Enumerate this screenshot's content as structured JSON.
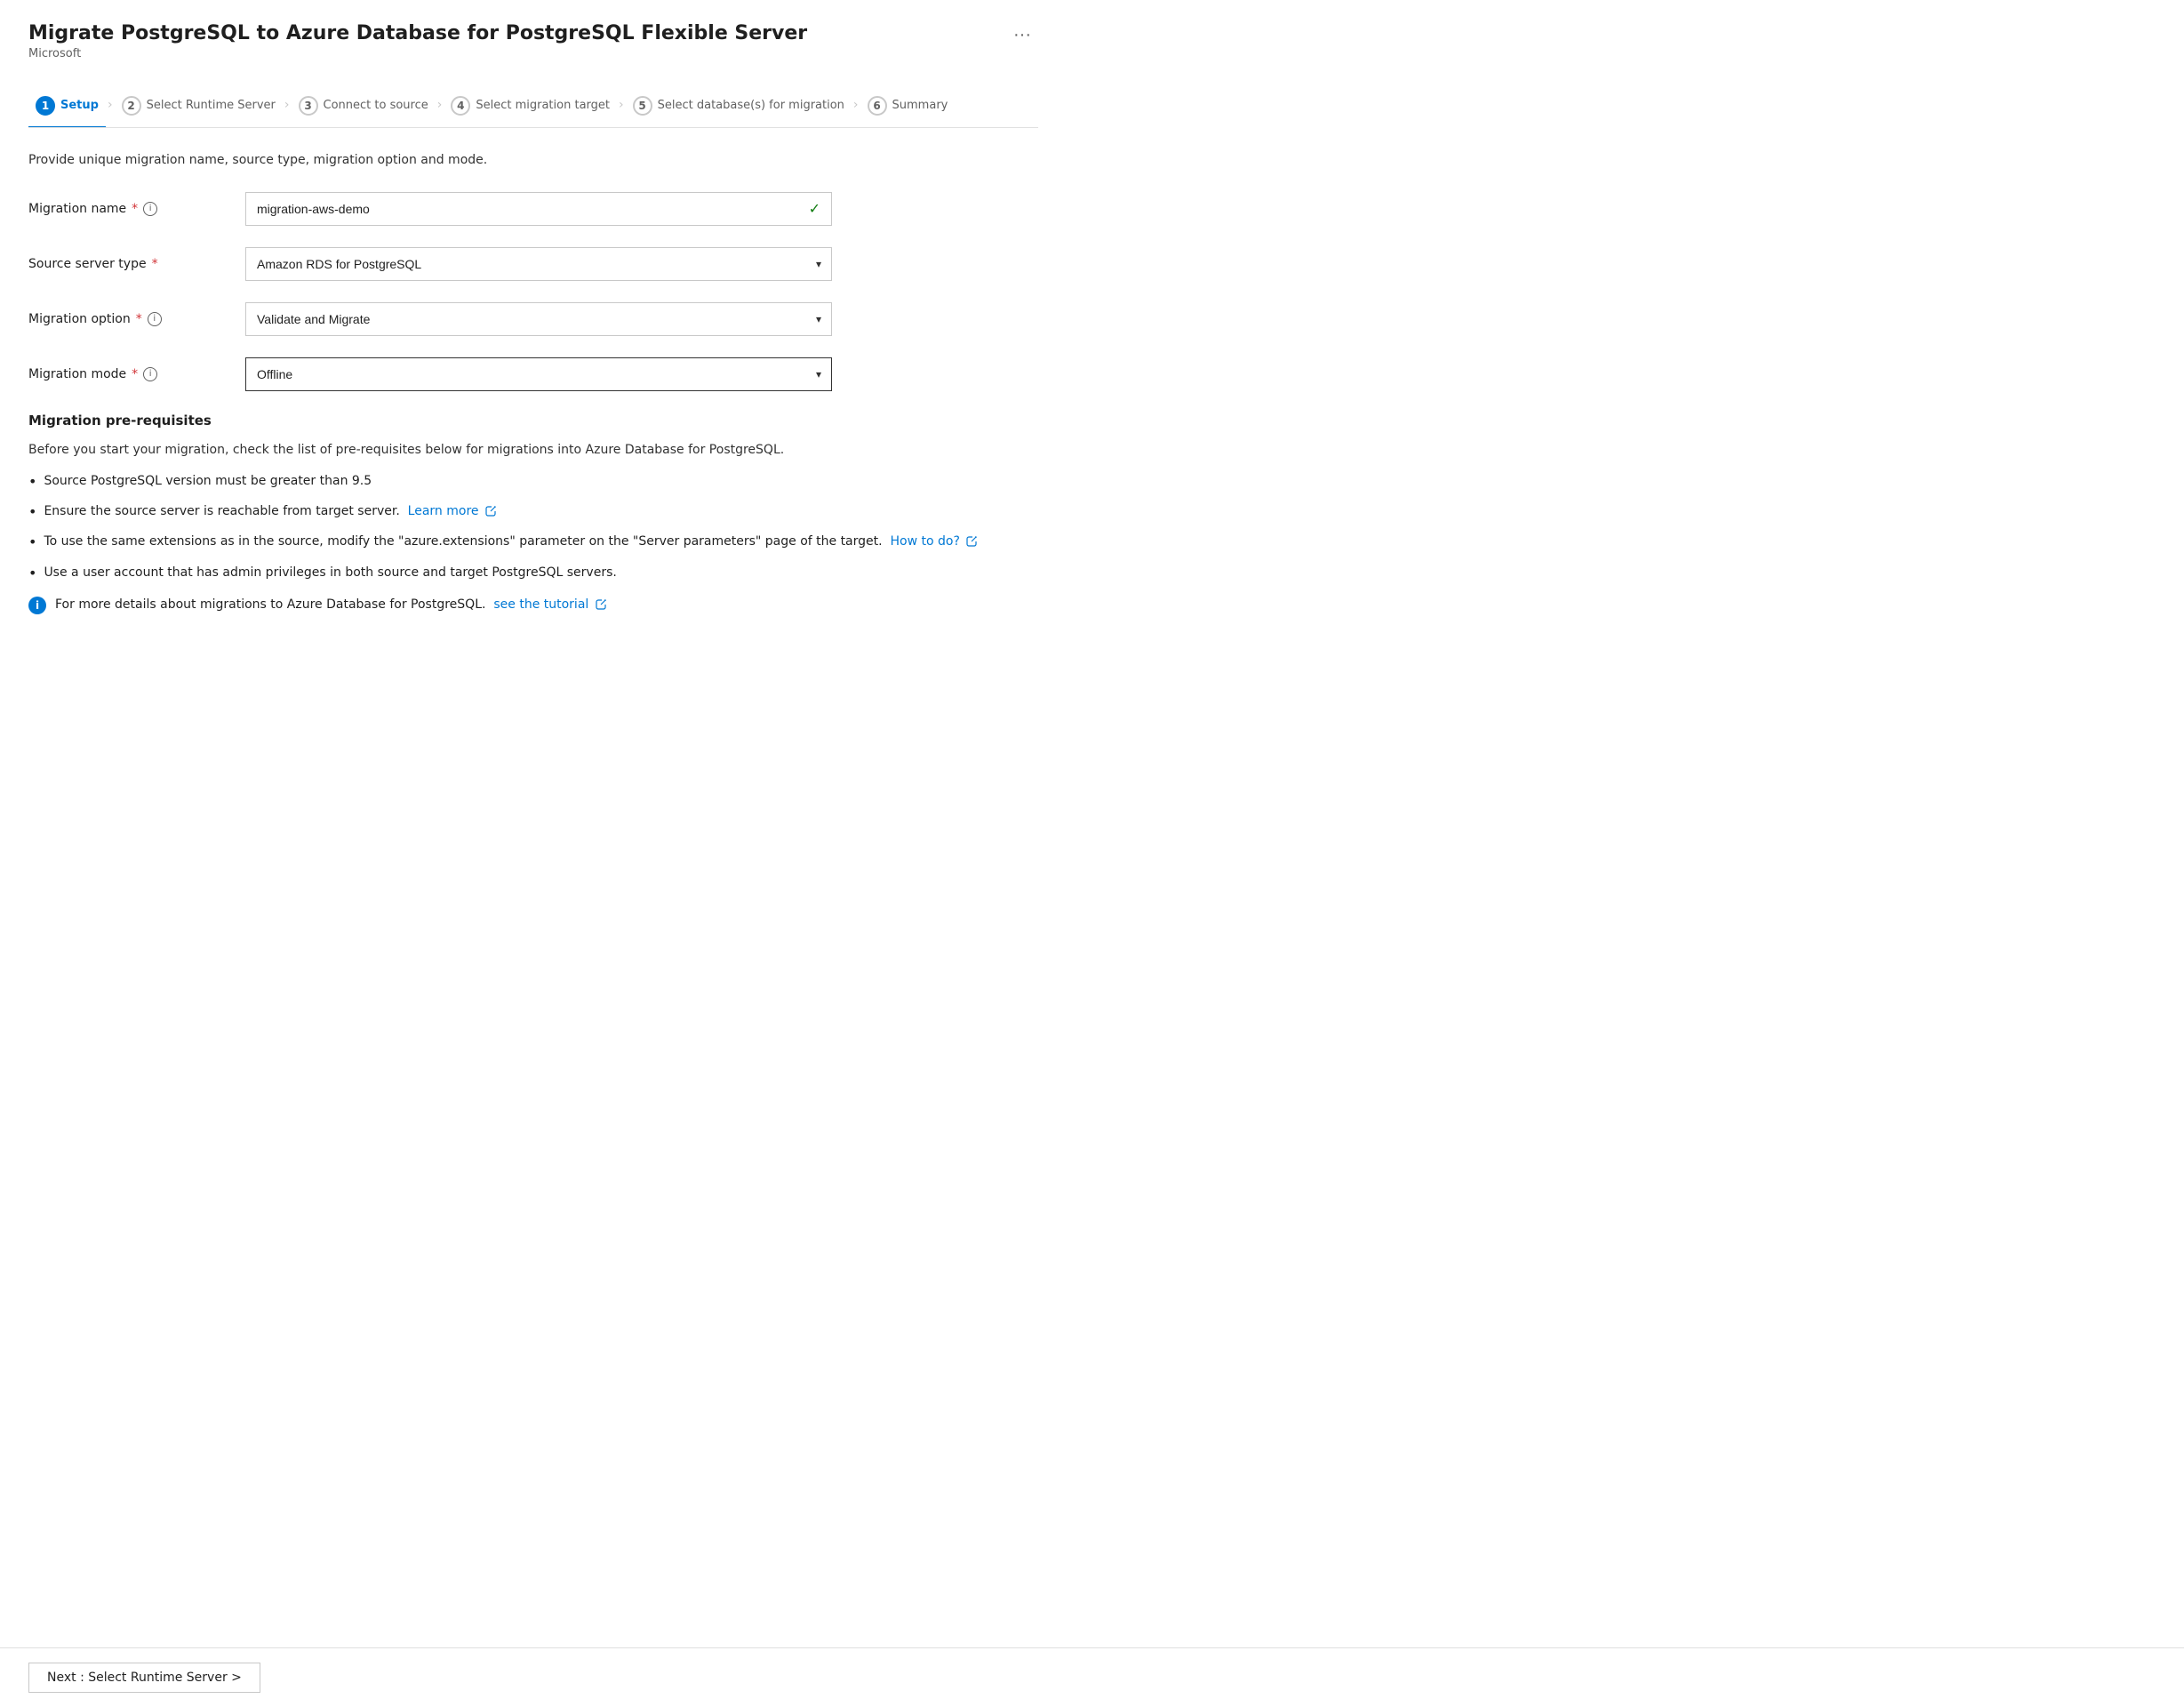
{
  "header": {
    "title": "Migrate PostgreSQL to Azure Database for PostgreSQL Flexible Server",
    "subtitle": "Microsoft",
    "ellipsis_label": "···"
  },
  "wizard": {
    "steps": [
      {
        "number": "1",
        "label": "Setup",
        "active": true
      },
      {
        "number": "2",
        "label": "Select Runtime Server",
        "active": false
      },
      {
        "number": "3",
        "label": "Connect to source",
        "active": false
      },
      {
        "number": "4",
        "label": "Select migration target",
        "active": false
      },
      {
        "number": "5",
        "label": "Select database(s) for migration",
        "active": false
      },
      {
        "number": "6",
        "label": "Summary",
        "active": false
      }
    ]
  },
  "form": {
    "description": "Provide unique migration name, source type, migration option and mode.",
    "fields": {
      "migration_name": {
        "label": "Migration name",
        "value": "migration-aws-demo",
        "required": true,
        "has_info": true
      },
      "source_server_type": {
        "label": "Source server type",
        "value": "Amazon RDS for PostgreSQL",
        "required": true,
        "has_info": false
      },
      "migration_option": {
        "label": "Migration option",
        "value": "Validate and Migrate",
        "required": true,
        "has_info": true
      },
      "migration_mode": {
        "label": "Migration mode",
        "value": "Offline",
        "required": true,
        "has_info": true
      }
    }
  },
  "prereq": {
    "title": "Migration pre-requisites",
    "description": "Before you start your migration, check the list of pre-requisites below for migrations into Azure Database for PostgreSQL.",
    "items": [
      {
        "text": "Source PostgreSQL version must be greater than 9.5",
        "link": null,
        "link_text": null
      },
      {
        "text": "Ensure the source server is reachable from target server.",
        "link": "#",
        "link_text": "Learn more"
      },
      {
        "text": "To use the same extensions as in the source, modify the \"azure.extensions\" parameter on the \"Server parameters\" page of the target.",
        "link": "#",
        "link_text": "How to do?"
      },
      {
        "text": "Use a user account that has admin privileges in both source and target PostgreSQL servers.",
        "link": null,
        "link_text": null
      }
    ],
    "info_text": "For more details about migrations to Azure Database for PostgreSQL.",
    "info_link_text": "see the tutorial",
    "info_link": "#"
  },
  "footer": {
    "next_button_label": "Next : Select Runtime Server >"
  }
}
